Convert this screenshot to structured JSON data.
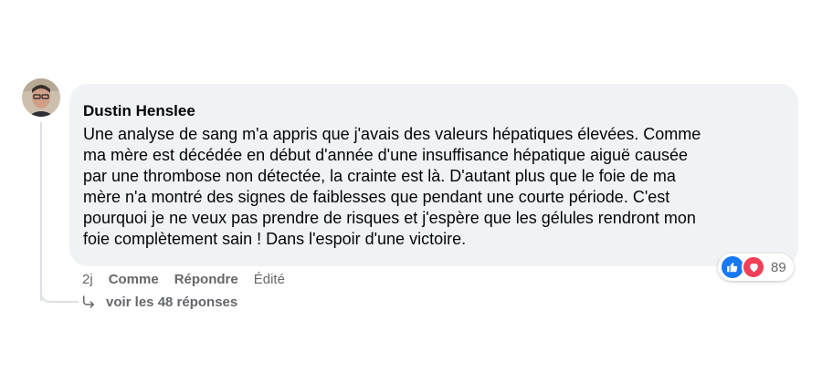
{
  "comment": {
    "author": "Dustin Henslee",
    "text": "Une analyse de sang m'a appris que j'avais des valeurs hépatiques élevées. Comme\nma mère est décédée en début d'année d'une insuffisance hépatique aiguë causée\npar une thrombose non détectée, la crainte est là. D'autant plus que le foie de ma\nmère n'a montré des signes de faiblesses que pendant une courte période. C'est\npourquoi je ne veux pas prendre de risques et j'espère que les gélules rendront mon\nfoie complètement sain ! Dans l'espoir d'une victoire.",
    "time": "2j",
    "like_label": "Comme",
    "reply_label": "Répondre",
    "edited_label": "Édité",
    "reaction_count": "89",
    "replies_label": "voir les 48 réponses"
  },
  "colors": {
    "bubble": "#f0f2f5",
    "like": "#1877f2",
    "love": "#f33e58",
    "muted": "#65676b"
  },
  "icons": [
    "avatar",
    "like-icon",
    "love-icon",
    "reply-arrow-icon"
  ]
}
